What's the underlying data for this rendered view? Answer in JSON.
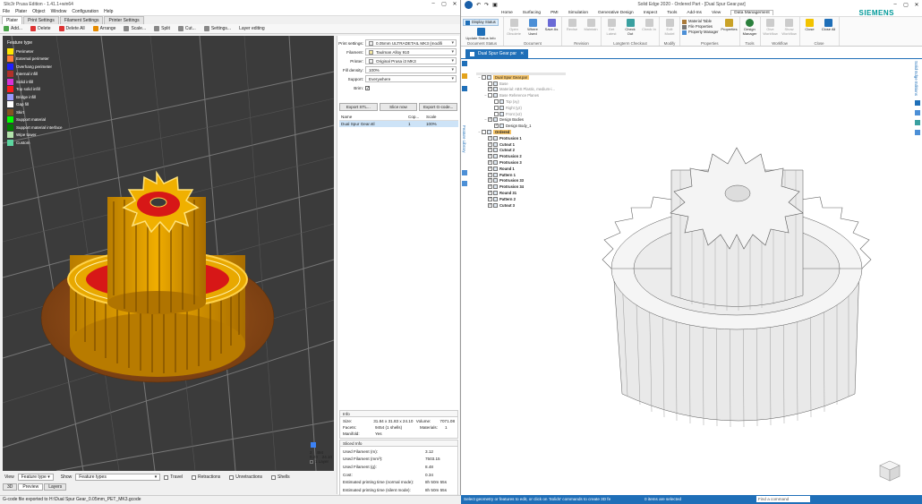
{
  "slicer": {
    "title": "Slic3r Prusa Edition - 1.41.1+win64",
    "menu": [
      "File",
      "Plater",
      "Object",
      "Window",
      "Configuration",
      "Help"
    ],
    "tabs": [
      "Plater",
      "Print Settings",
      "Filament Settings",
      "Printer Settings"
    ],
    "toolbar": [
      "Add...",
      "Delete",
      "Delete All",
      "Arrange",
      "Scale...",
      "Split",
      "Cut...",
      "Settings...",
      "Layer editing"
    ],
    "legend": {
      "title": "Feature type",
      "items": [
        {
          "label": "Perimeter",
          "color": "#ffe600"
        },
        {
          "label": "External perimeter",
          "color": "#ff7d38"
        },
        {
          "label": "Overhang perimeter",
          "color": "#1f1fff"
        },
        {
          "label": "Internal infill",
          "color": "#b03029"
        },
        {
          "label": "Solid infill",
          "color": "#d732d7"
        },
        {
          "label": "Top solid infill",
          "color": "#ff1a1a"
        },
        {
          "label": "Bridge infill",
          "color": "#9999ff"
        },
        {
          "label": "Gap fill",
          "color": "#ffffff"
        },
        {
          "label": "Skirt",
          "color": "#845321"
        },
        {
          "label": "Support material",
          "color": "#00ff00"
        },
        {
          "label": "Support material interface",
          "color": "#008000"
        },
        {
          "label": "Wipe tower",
          "color": "#b3e3ab"
        },
        {
          "label": "Custom",
          "color": "#5ed6a0"
        }
      ]
    },
    "slider": {
      "top": "2",
      "top_h": "494",
      "bottom": "0.20",
      "bottom_h": "24.10",
      "one_layer": "1 Layer"
    },
    "viewbar": {
      "view_label": "View",
      "view_value": "Feature type",
      "show_label": "Show",
      "show_value": "Feature types",
      "travel": "Travel",
      "retractions": "Retractions",
      "unretractions": "Unretractions",
      "shells": "Shells"
    },
    "viewtabs": [
      "3D",
      "Preview",
      "Layers"
    ],
    "status": "G-code file exported to H:\\Dual Spur Gear_0.05mm_PET_MK3.gcode",
    "settings": {
      "print_label": "Print settings:",
      "print_value": "0.05mm ULTRADETAIL MK3 (modifi",
      "filament_label": "Filament:",
      "filament_value": "Taulman Alloy 910",
      "printer_label": "Printer:",
      "printer_value": "Original Prusa i3 MK3",
      "fill_label": "Fill density:",
      "fill_value": "100%",
      "support_label": "Support:",
      "support_value": "Everywhere",
      "brim_label": "Brim:"
    },
    "actions": [
      "Export STL...",
      "Slice now",
      "Export G-code..."
    ],
    "objects": {
      "headers": [
        "Name",
        "Cop...",
        "Scale"
      ],
      "rows": [
        [
          "Dual Spur Gear.stl",
          "1",
          "100%"
        ]
      ]
    },
    "info": {
      "title": "Info",
      "size_label": "Size:",
      "size_value": "31.84 x 31.83 x 24.10",
      "volume_label": "Volume:",
      "volume_value": "7071.08",
      "facets_label": "Facets:",
      "facets_value": "9454 (1 shells)",
      "materials_label": "Materials:",
      "materials_value": "1",
      "manifold_label": "Manifold:",
      "manifold_value": "Yes"
    },
    "sliced": {
      "title": "Sliced Info",
      "rows": [
        [
          "Used Filament (m):",
          "3.12"
        ],
        [
          "Used Filament (mm³):",
          "7503.15"
        ],
        [
          "Used Filament (g):",
          "8.48"
        ],
        [
          "Cost:",
          "0.34"
        ],
        [
          "Estimated printing time (normal mode):",
          "8h 50m 55s"
        ],
        [
          "Estimated printing time (silent mode):",
          "8h 50m 55s"
        ]
      ]
    }
  },
  "cad": {
    "title": "Solid Edge 2020 - Ordered Part - [Dual Spur Gear.par]",
    "tabs": [
      "Home",
      "Surfacing",
      "PMI",
      "Simulation",
      "Generative Design",
      "Inspect",
      "Tools",
      "Add-Ins",
      "View",
      "Data Management"
    ],
    "brand": "SIEMENS",
    "ribbon": {
      "display_status": "Display Status",
      "update_status": "Update Status Info",
      "document_status": "Document Status",
      "revise": "Revise",
      "open_obsolete": "Open Obsolete",
      "where_used": "Where Used",
      "save_as": "Save As",
      "document": "Document",
      "revision": "Revision",
      "maintain": "Maintain",
      "get_latest": "Get Latest",
      "check_out": "Check Out",
      "check_in": "Check In",
      "longterm_checkout": "Longterm Checkout",
      "edit_model": "Edit Model",
      "modify": "Modify",
      "material_table": "Material Table",
      "file_properties": "File Properties",
      "property_manager": "Property Manager",
      "properties": "Properties",
      "properties_group": "Properties",
      "design_manager": "Design Manager",
      "tools": "Tools",
      "give_workflow": "Give Workflow",
      "show_workflow": "Show Workflow",
      "workflow": "Workflow",
      "close": "Close",
      "close_all": "Close All",
      "close_group": "Close"
    },
    "doc_tab": "Dual Spur Gear.par",
    "path_finder": "PathFinder",
    "feature_library": "Feature Library",
    "tree": [
      {
        "label": "Dual Spur Gear.par",
        "level": 0
      },
      {
        "label": "Base",
        "level": 1
      },
      {
        "label": "Material: ABS Plastic, medium-i...",
        "level": 1
      },
      {
        "label": "Base Reference Planes",
        "level": 1
      },
      {
        "label": "Top (xy)",
        "level": 2
      },
      {
        "label": "Right (yz)",
        "level": 2
      },
      {
        "label": "Front (xz)",
        "level": 2
      },
      {
        "label": "Design Bodies",
        "level": 1
      },
      {
        "label": "Design Body_1",
        "level": 2
      },
      {
        "label": "Ordered",
        "level": 0
      },
      {
        "label": "Protrusion 1",
        "level": 1
      },
      {
        "label": "Cutout 1",
        "level": 1
      },
      {
        "label": "Cutout 2",
        "level": 1
      },
      {
        "label": "Protrusion 2",
        "level": 1
      },
      {
        "label": "Protrusion 3",
        "level": 1
      },
      {
        "label": "Round 1",
        "level": 1
      },
      {
        "label": "Pattern 1",
        "level": 1
      },
      {
        "label": "Protrusion 33",
        "level": 1
      },
      {
        "label": "Protrusion 34",
        "level": 1
      },
      {
        "label": "Round 31",
        "level": 1
      },
      {
        "label": "Pattern 2",
        "level": 1
      },
      {
        "label": "Cutout 3",
        "level": 1
      }
    ],
    "status_left": "Select geometry or features to edit, or click on 'Solids' commands to create 3D fe",
    "status_center": "0 items are selected",
    "find_placeholder": "Find a command",
    "side_label": "Solid Edge Editions"
  }
}
